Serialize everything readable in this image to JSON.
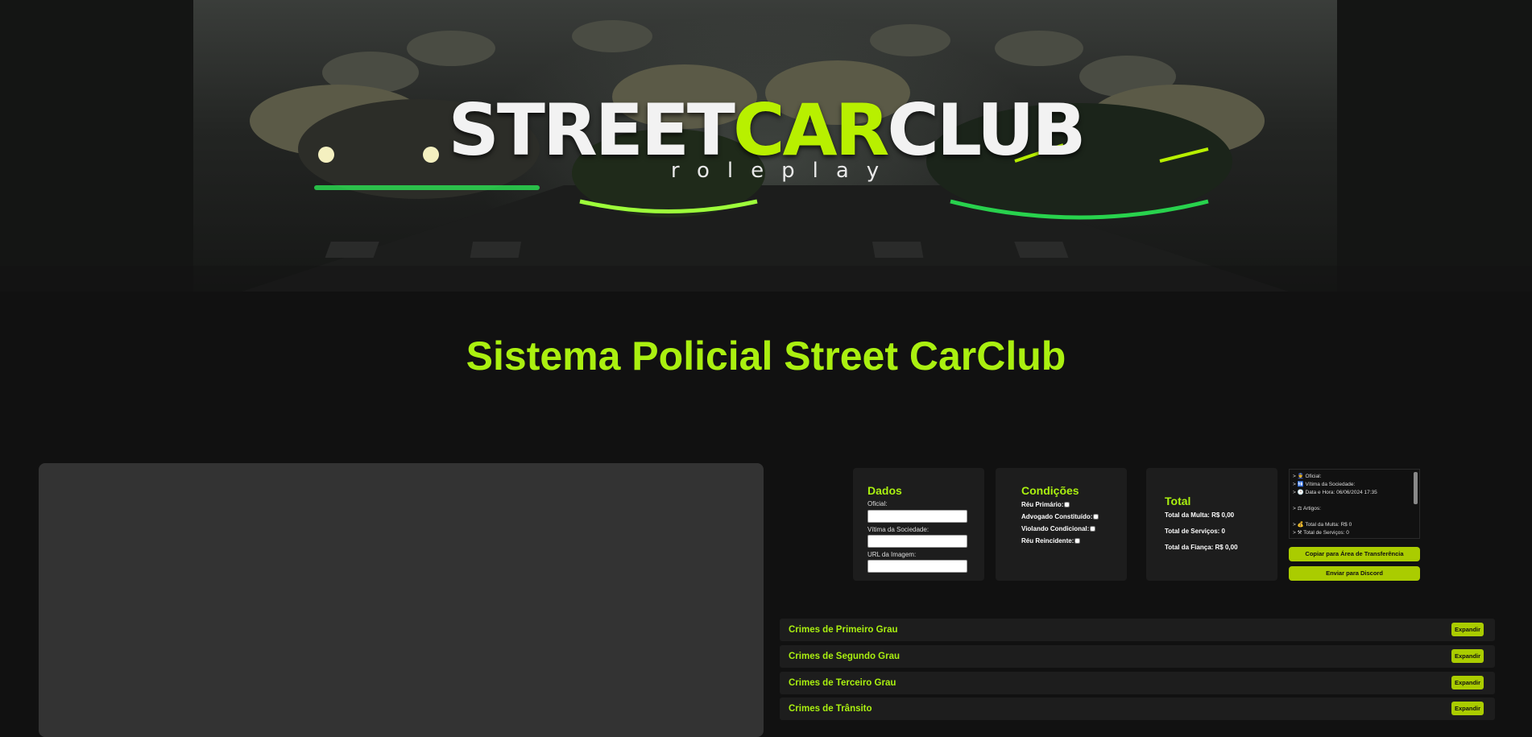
{
  "banner": {
    "logo_street": "STREET",
    "logo_car": "CAR",
    "logo_club": "CLUB",
    "logo_sub": "roleplay"
  },
  "page_title": "Sistema Policial Street CarClub",
  "dados": {
    "title": "Dados",
    "oficial_label": "Oficial:",
    "oficial_value": "",
    "vitima_label": "Vítima da Sociedade:",
    "vitima_value": "",
    "url_label": "URL da Imagem:",
    "url_value": ""
  },
  "condicoes": {
    "title": "Condições",
    "items": [
      {
        "label": "Réu Primário:",
        "checked": false
      },
      {
        "label": "Advogado Constituído:",
        "checked": false
      },
      {
        "label": "Violando Condicional:",
        "checked": false
      },
      {
        "label": "Réu Reincidente:",
        "checked": false
      }
    ]
  },
  "total": {
    "title": "Total",
    "multa": "Total da Multa: R$ 0,00",
    "servicos": "Total de Serviços: 0",
    "fianca": "Total da Fiança: R$ 0,00"
  },
  "output": {
    "text": "> 👮 Oficial:\n> 🚻 Vítima da Sociedade:\n> 🕒 Data e Hora: 06/06/2024 17:35\n\n> ⚖ Artigos:\n\n> 💰 Total da Multa: R$ 0\n> ⚒ Total de Serviços: 0"
  },
  "buttons": {
    "copy": "Copiar para Área de Transferência",
    "discord": "Enviar para Discord"
  },
  "crimes": [
    {
      "label": "Crimes de Primeiro Grau",
      "button": "Expandir"
    },
    {
      "label": "Crimes de Segundo Grau",
      "button": "Expandir"
    },
    {
      "label": "Crimes de Terceiro Grau",
      "button": "Expandir"
    },
    {
      "label": "Crimes de Trânsito",
      "button": "Expandir"
    }
  ],
  "colors": {
    "accent": "#aaf010",
    "button": "#aacc00",
    "background": "#111111",
    "card": "#1d1d1d"
  }
}
